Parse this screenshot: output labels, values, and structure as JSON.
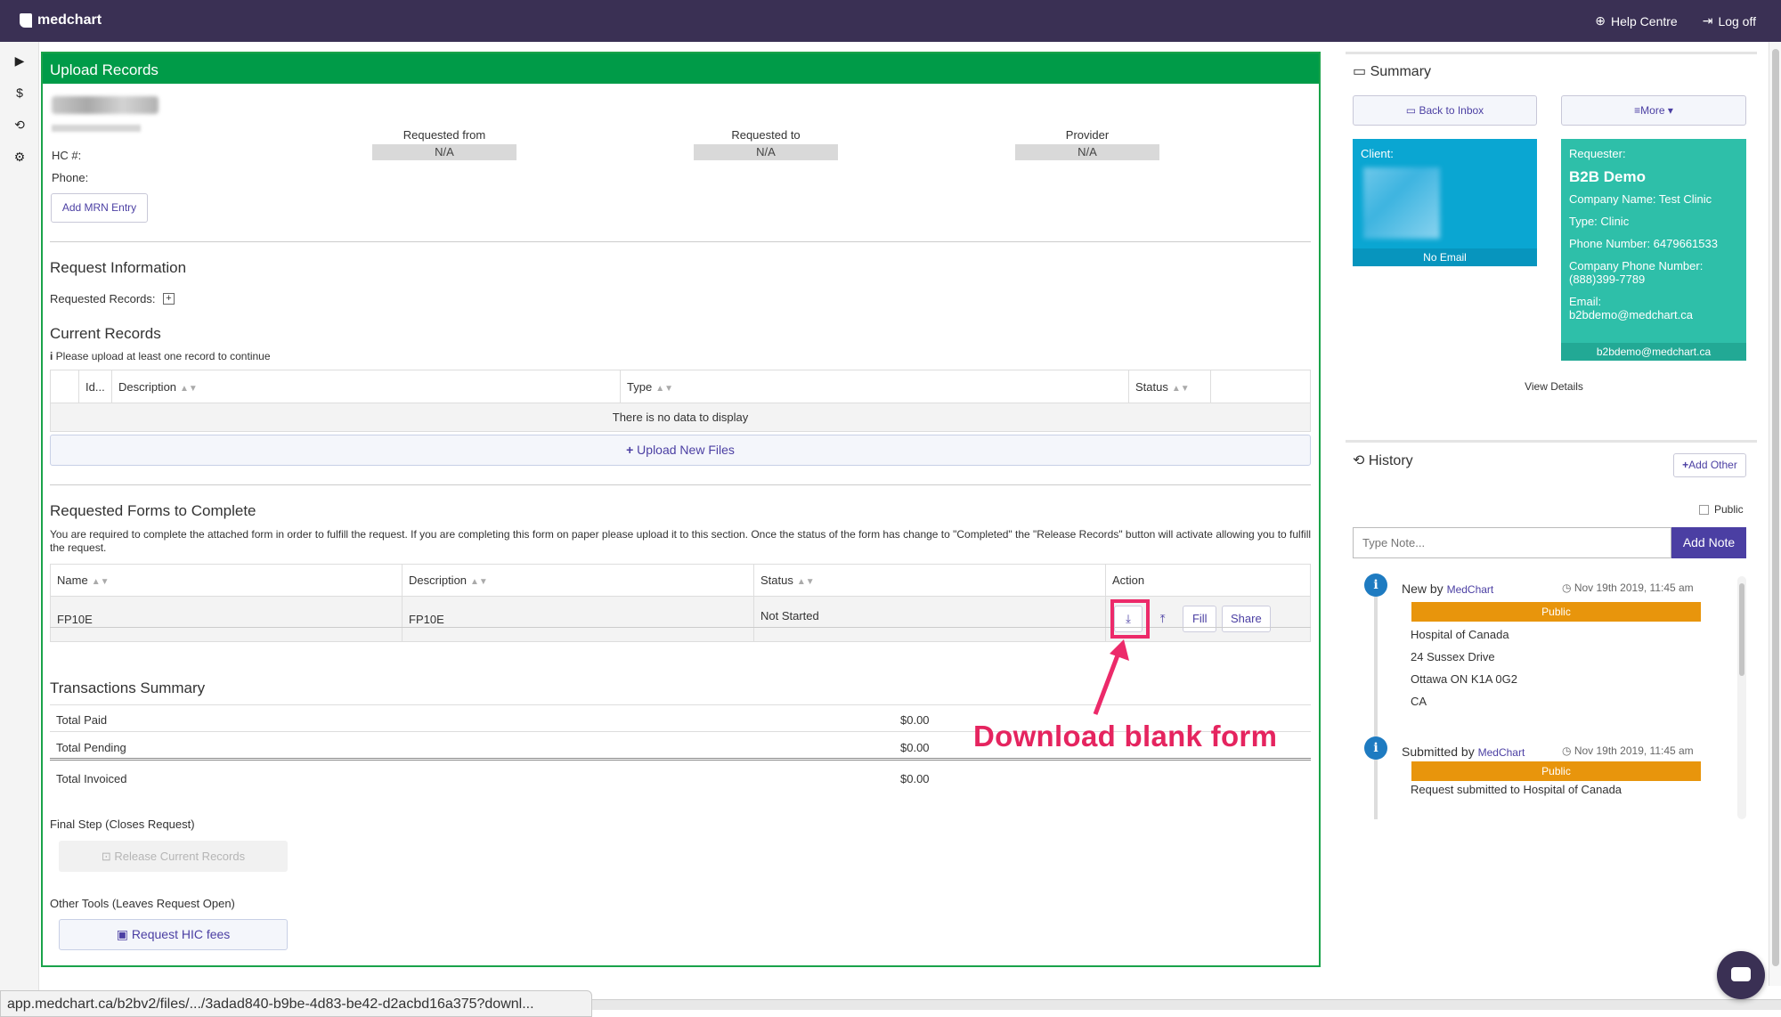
{
  "topbar": {
    "brand": "medchart",
    "help": "Help Centre",
    "logoff": "Log off"
  },
  "sidebar": {
    "icons": [
      "play-icon",
      "dollar-icon",
      "history-icon",
      "gear-icon"
    ],
    "play": "▶",
    "dollar": "$",
    "history": "⟲",
    "gear": "⚙"
  },
  "upload": {
    "title": "Upload Records",
    "hc_label": "HC #:",
    "phone_label": "Phone:",
    "add_mrn": "Add MRN Entry",
    "fields": [
      {
        "label": "Requested from",
        "value": "N/A"
      },
      {
        "label": "Requested to",
        "value": "N/A"
      },
      {
        "label": "Provider",
        "value": "N/A"
      }
    ]
  },
  "request_info": {
    "title": "Request Information",
    "requested_records_label": "Requested Records:"
  },
  "current_records": {
    "title": "Current Records",
    "note": "Please upload at least one record to continue",
    "columns": [
      "Id...",
      "Description",
      "Type",
      "Status"
    ],
    "empty": "There is no data to display",
    "upload_btn": "Upload New Files"
  },
  "forms": {
    "title": "Requested Forms to Complete",
    "description": "You are required to complete the attached form in order to fulfill the request. If you are completing this form on paper please upload it to this section. Once the status of the form has change to \"Completed\" the \"Release Records\" button will activate allowing you to fulfill the request.",
    "columns": [
      "Name",
      "Description",
      "Status",
      "Action"
    ],
    "rows": [
      {
        "name": "FP10E",
        "description": "FP10E",
        "status": "Not Started"
      }
    ],
    "fill": "Fill",
    "share": "Share"
  },
  "transactions": {
    "title": "Transactions Summary",
    "rows": [
      {
        "label": "Total Paid",
        "amount": "$0.00"
      },
      {
        "label": "Total Pending",
        "amount": "$0.00"
      },
      {
        "label": "Total Invoiced",
        "amount": "$0.00"
      }
    ]
  },
  "final_step": {
    "label": "Final Step (Closes Request)",
    "release_btn": "Release Current Records",
    "other_label": "Other Tools (Leaves Request Open)",
    "hic_btn": "Request HIC fees"
  },
  "summary": {
    "title": "Summary",
    "back_btn": "Back to Inbox",
    "more_btn": "More",
    "client_label": "Client:",
    "client_email": "No Email",
    "requester_label": "Requester:",
    "requester_name": "B2B Demo",
    "company": "Company Name: Test Clinic",
    "type": "Type: Clinic",
    "phone": "Phone Number: 6479661533",
    "company_phone": "Company Phone Number: (888)399-7789",
    "email_label": "Email:",
    "email": "b2bdemo@medchart.ca",
    "footer_email": "b2bdemo@medchart.ca",
    "view_details": "View Details"
  },
  "history": {
    "title": "History",
    "add_other": "Add Other",
    "public_label": "Public",
    "note_placeholder": "Type Note...",
    "add_note": "Add Note",
    "items": [
      {
        "action": "New by",
        "who": "MedChart",
        "time": "Nov 19th 2019, 11:45 am",
        "badge": "Public",
        "lines": [
          "Hospital of Canada",
          "24 Sussex Drive",
          "Ottawa ON K1A 0G2",
          "CA"
        ]
      },
      {
        "action": "Submitted by",
        "who": "MedChart",
        "time": "Nov 19th 2019, 11:45 am",
        "badge": "Public",
        "lines": [
          "Request submitted to Hospital of Canada"
        ]
      }
    ]
  },
  "annotation": "Download blank form",
  "status_url": "app.medchart.ca/b2bv2/files/.../3adad840-b9be-4d83-be42-d2acbd16a375?downl..."
}
